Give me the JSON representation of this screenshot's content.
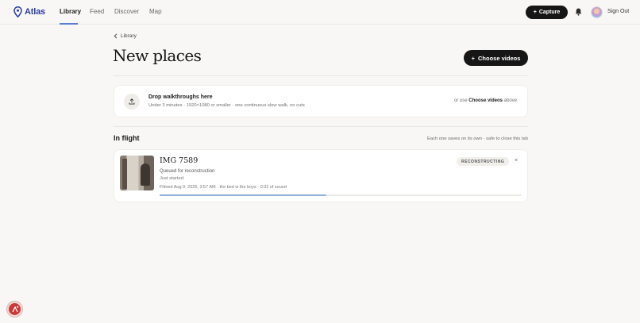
{
  "app": {
    "name": "Atlas",
    "brand_color": "#2b3a9a"
  },
  "nav": {
    "items": [
      {
        "label": "Library",
        "active": true
      },
      {
        "label": "Feed",
        "active": false
      },
      {
        "label": "Discover",
        "active": false
      },
      {
        "label": "Map",
        "active": false
      }
    ],
    "capture_label": "Capture",
    "signout_label": "Sign Out"
  },
  "breadcrumb": {
    "label": "Library"
  },
  "page": {
    "title": "New places",
    "choose_videos_label": "Choose videos"
  },
  "dropzone": {
    "title": "Drop walkthroughs here",
    "subtitle": "Under 3 minutes · 1920×1080 or smaller · one continuous slow walk, no cuts",
    "right_prefix": "or use",
    "right_link": "Choose videos",
    "right_suffix": "above"
  },
  "in_flight": {
    "title": "In flight",
    "note": "Each one saves on its own · safe to close this tab",
    "items": [
      {
        "title": "IMG 7589",
        "status": "Queued for reconstruction",
        "substatus": "Just started.",
        "meta": "Filmed Aug 9, 2026, 3:57 AM · the bed w the boys · 0:32 of sound",
        "badge": "RECONSTRUCTING",
        "close": "×",
        "progress": 0.46
      }
    ]
  }
}
